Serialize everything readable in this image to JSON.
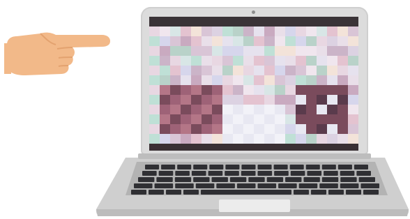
{
  "illustration": {
    "hand_icon": "pointing-hand-icon",
    "laptop_icon": "laptop-icon",
    "colors": {
      "skin": "#f2b989",
      "skin_shadow": "#e3a26f",
      "lid": "#dcdcdc",
      "base": "#c9c9c9",
      "keyboard_bed": "#a9a9a9",
      "keys": "#2f2f33",
      "trackpad": "#ececec",
      "screen_frame": "#3d3438"
    },
    "screen_mosaic_palette": [
      "#e8d7e2",
      "#d9c5d6",
      "#e6e2ee",
      "#f0e6ee",
      "#dcd2e2",
      "#c9aac0",
      "#d8e6e6",
      "#bfe0d6",
      "#e9dfe9",
      "#e4c3d0",
      "#b9d2c9",
      "#d6d6ec",
      "#f3e3d9",
      "#cbb4c8",
      "#9e6277",
      "#b47687",
      "#7a4b5c",
      "#5a3b4c",
      "#e8e8f2",
      "#f2f2f8",
      "#c7a0b3",
      "#8f6a80",
      "#d9bccb",
      "#bda3b6"
    ]
  }
}
